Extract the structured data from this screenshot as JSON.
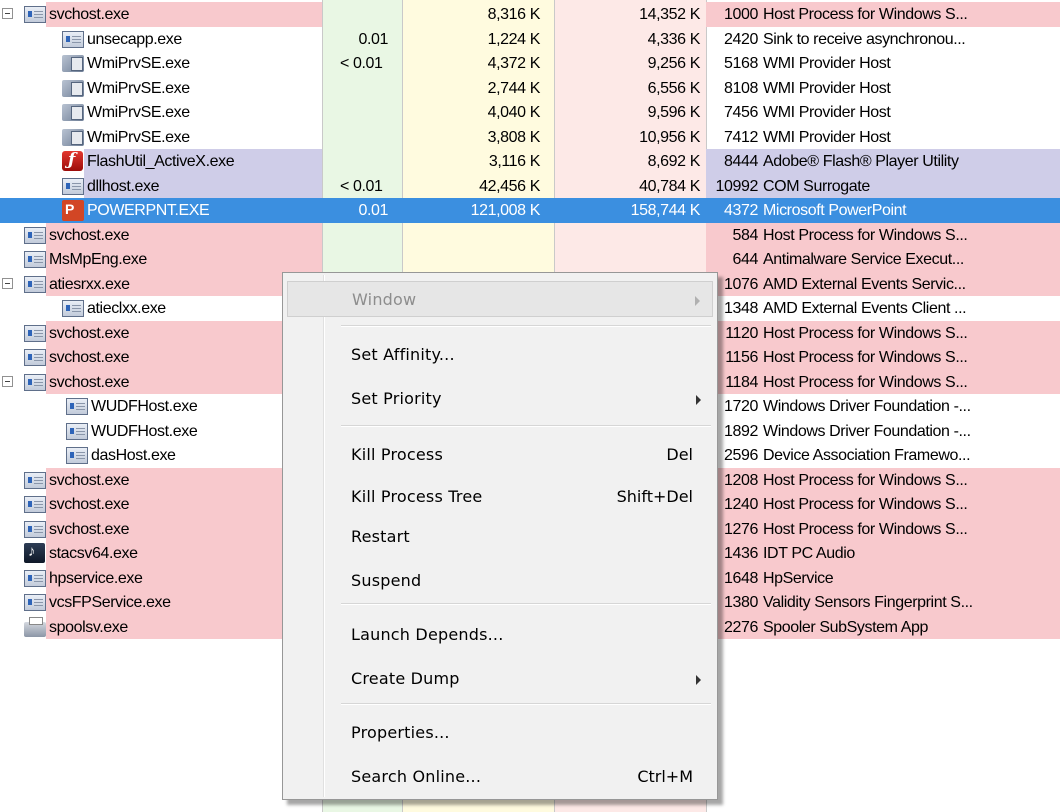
{
  "rows": [
    {
      "name": "svchost.exe",
      "cpu": "",
      "priv": "8,316 K",
      "work": "14,352 K",
      "pid": "1000",
      "desc": "Host Process for Windows S...",
      "icon": "exe-icon",
      "style": "svc",
      "indent": 0,
      "toggle": true
    },
    {
      "name": "unsecapp.exe",
      "cpu": "0.01",
      "priv": "1,224 K",
      "work": "4,336 K",
      "pid": "2420",
      "desc": "Sink to receive asynchronou...",
      "icon": "exe-icon",
      "style": "",
      "indent": 1,
      "toggle": false
    },
    {
      "name": "WmiPrvSE.exe",
      "cpu": "< 0.01",
      "priv": "4,372 K",
      "work": "9,256 K",
      "pid": "5168",
      "desc": "WMI Provider Host",
      "icon": "wmi-icon",
      "style": "",
      "indent": 1,
      "toggle": false
    },
    {
      "name": "WmiPrvSE.exe",
      "cpu": "",
      "priv": "2,744 K",
      "work": "6,556 K",
      "pid": "8108",
      "desc": "WMI Provider Host",
      "icon": "wmi-icon",
      "style": "",
      "indent": 1,
      "toggle": false
    },
    {
      "name": "WmiPrvSE.exe",
      "cpu": "",
      "priv": "4,040 K",
      "work": "9,596 K",
      "pid": "7456",
      "desc": "WMI Provider Host",
      "icon": "wmi-icon",
      "style": "",
      "indent": 1,
      "toggle": false
    },
    {
      "name": "WmiPrvSE.exe",
      "cpu": "",
      "priv": "3,808 K",
      "work": "10,956 K",
      "pid": "7412",
      "desc": "WMI Provider Host",
      "icon": "wmi-icon",
      "style": "",
      "indent": 1,
      "toggle": false
    },
    {
      "name": "FlashUtil_ActiveX.exe",
      "cpu": "",
      "priv": "3,116 K",
      "work": "8,692 K",
      "pid": "8444",
      "desc": "Adobe® Flash® Player Utility",
      "icon": "flash-icon",
      "style": "purple",
      "indent": 1,
      "toggle": false
    },
    {
      "name": "dllhost.exe",
      "cpu": "< 0.01",
      "priv": "42,456 K",
      "work": "40,784 K",
      "pid": "10992",
      "desc": "COM Surrogate",
      "icon": "exe-icon",
      "style": "purple",
      "indent": 1,
      "toggle": false
    },
    {
      "name": "POWERPNT.EXE",
      "cpu": "0.01",
      "priv": "121,008 K",
      "work": "158,744 K",
      "pid": "4372",
      "desc": "Microsoft PowerPoint",
      "icon": "powerpoint-icon",
      "style": "sel",
      "indent": 1,
      "toggle": false
    },
    {
      "name": "svchost.exe",
      "cpu": "",
      "priv": "",
      "work": "",
      "pid": "584",
      "desc": "Host Process for Windows S...",
      "icon": "exe-icon",
      "style": "svc",
      "indent": 0,
      "toggle": false
    },
    {
      "name": "MsMpEng.exe",
      "cpu": "",
      "priv": "",
      "work": "",
      "pid": "644",
      "desc": "Antimalware Service Execut...",
      "icon": "exe-icon",
      "style": "svc",
      "indent": 0,
      "toggle": false
    },
    {
      "name": "atiesrxx.exe",
      "cpu": "",
      "priv": "",
      "work": "",
      "pid": "1076",
      "desc": "AMD External Events Servic...",
      "icon": "exe-icon",
      "style": "svc",
      "indent": 0,
      "toggle": true
    },
    {
      "name": "atieclxx.exe",
      "cpu": "",
      "priv": "",
      "work": "",
      "pid": "1348",
      "desc": "AMD External Events Client ...",
      "icon": "exe-icon",
      "style": "",
      "indent": 1,
      "toggle": false
    },
    {
      "name": "svchost.exe",
      "cpu": "",
      "priv": "",
      "work": "",
      "pid": "1120",
      "desc": "Host Process for Windows S...",
      "icon": "exe-icon",
      "style": "svc",
      "indent": 0,
      "toggle": false
    },
    {
      "name": "svchost.exe",
      "cpu": "",
      "priv": "",
      "work": "",
      "pid": "1156",
      "desc": "Host Process for Windows S...",
      "icon": "exe-icon",
      "style": "svc",
      "indent": 0,
      "toggle": false
    },
    {
      "name": "svchost.exe",
      "cpu": "",
      "priv": "",
      "work": "",
      "pid": "1184",
      "desc": "Host Process for Windows S...",
      "icon": "exe-icon",
      "style": "svc",
      "indent": 0,
      "toggle": true
    },
    {
      "name": "WUDFHost.exe",
      "cpu": "",
      "priv": "",
      "work": "",
      "pid": "1720",
      "desc": "Windows Driver Foundation -...",
      "icon": "exe-icon",
      "style": "",
      "indent": 2,
      "toggle": false
    },
    {
      "name": "WUDFHost.exe",
      "cpu": "",
      "priv": "",
      "work": "",
      "pid": "1892",
      "desc": "Windows Driver Foundation -...",
      "icon": "exe-icon",
      "style": "",
      "indent": 2,
      "toggle": false
    },
    {
      "name": "dasHost.exe",
      "cpu": "",
      "priv": "",
      "work": "",
      "pid": "2596",
      "desc": "Device Association Framewo...",
      "icon": "exe-icon",
      "style": "",
      "indent": 2,
      "toggle": false
    },
    {
      "name": "svchost.exe",
      "cpu": "",
      "priv": "",
      "work": "",
      "pid": "1208",
      "desc": "Host Process for Windows S...",
      "icon": "exe-icon",
      "style": "svc",
      "indent": 0,
      "toggle": false
    },
    {
      "name": "svchost.exe",
      "cpu": "",
      "priv": "",
      "work": "",
      "pid": "1240",
      "desc": "Host Process for Windows S...",
      "icon": "exe-icon",
      "style": "svc",
      "indent": 0,
      "toggle": false
    },
    {
      "name": "svchost.exe",
      "cpu": "",
      "priv": "",
      "work": "",
      "pid": "1276",
      "desc": "Host Process for Windows S...",
      "icon": "exe-icon",
      "style": "svc",
      "indent": 0,
      "toggle": false
    },
    {
      "name": "stacsv64.exe",
      "cpu": "",
      "priv": "",
      "work": "",
      "pid": "1436",
      "desc": "IDT PC Audio",
      "icon": "music-note-icon",
      "style": "svc",
      "indent": 0,
      "toggle": false
    },
    {
      "name": "hpservice.exe",
      "cpu": "",
      "priv": "",
      "work": "",
      "pid": "1648",
      "desc": "HpService",
      "icon": "exe-icon",
      "style": "svc",
      "indent": 0,
      "toggle": false
    },
    {
      "name": "vcsFPService.exe",
      "cpu": "",
      "priv": "",
      "work": "",
      "pid": "1380",
      "desc": "Validity Sensors Fingerprint S...",
      "icon": "exe-icon",
      "style": "svc",
      "indent": 0,
      "toggle": false
    },
    {
      "name": "spoolsv.exe",
      "cpu": "",
      "priv": "",
      "work": "",
      "pid": "2276",
      "desc": "Spooler SubSystem App",
      "icon": "printer-icon",
      "style": "svc",
      "indent": 0,
      "toggle": false
    }
  ],
  "context_menu": {
    "items": [
      {
        "label": "Window",
        "shortcut": "",
        "submenu": true,
        "disabled": true,
        "hover": true
      },
      {
        "label": "Set Affinity...",
        "shortcut": "",
        "submenu": false,
        "disabled": false
      },
      {
        "label": "Set Priority",
        "shortcut": "",
        "submenu": true,
        "disabled": false
      },
      {
        "label": "Kill Process",
        "shortcut": "Del",
        "submenu": false,
        "disabled": false
      },
      {
        "label": "Kill Process Tree",
        "shortcut": "Shift+Del",
        "submenu": false,
        "disabled": false
      },
      {
        "label": "Restart",
        "shortcut": "",
        "submenu": false,
        "disabled": false
      },
      {
        "label": "Suspend",
        "shortcut": "",
        "submenu": false,
        "disabled": false
      },
      {
        "label": "Launch Depends...",
        "shortcut": "",
        "submenu": false,
        "disabled": false
      },
      {
        "label": "Create Dump",
        "shortcut": "",
        "submenu": true,
        "disabled": false
      },
      {
        "label": "Properties...",
        "shortcut": "",
        "submenu": false,
        "disabled": false
      },
      {
        "label": "Search Online...",
        "shortcut": "Ctrl+M",
        "submenu": false,
        "disabled": false
      }
    ]
  },
  "colors": {
    "service_row": "#f8c9cd",
    "own_process_row": "#cfcde8",
    "selected_row": "#3b8fe0",
    "cpu_column": "#e9f7e4",
    "private_bytes_column": "#fffbdf",
    "working_set_column": "#fde9e7"
  }
}
